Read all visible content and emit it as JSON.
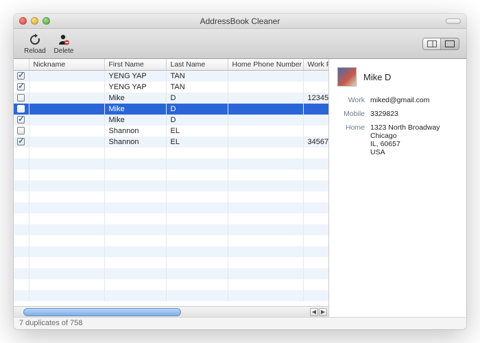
{
  "window": {
    "title": "AddressBook Cleaner"
  },
  "toolbar": {
    "reload_label": "Reload",
    "delete_label": "Delete"
  },
  "columns": {
    "check": "",
    "nickname": "Nickname",
    "first": "First Name",
    "last": "Last Name",
    "homephone": "Home Phone Number",
    "workphone": "Work Ph"
  },
  "rows": [
    {
      "checked": true,
      "nickname": "",
      "first": "YENG YAP",
      "last": "TAN",
      "homephone": "",
      "workphone": ""
    },
    {
      "checked": true,
      "nickname": "",
      "first": "YENG YAP",
      "last": "TAN",
      "homephone": "",
      "workphone": ""
    },
    {
      "checked": false,
      "nickname": "",
      "first": "Mike",
      "last": "D",
      "homephone": "",
      "workphone": "12345"
    },
    {
      "checked": true,
      "nickname": "",
      "first": "Mike",
      "last": "D",
      "homephone": "",
      "workphone": "",
      "selected": true
    },
    {
      "checked": true,
      "nickname": "",
      "first": "Mike",
      "last": "D",
      "homephone": "",
      "workphone": ""
    },
    {
      "checked": false,
      "nickname": "",
      "first": "Shannon",
      "last": "EL",
      "homephone": "",
      "workphone": ""
    },
    {
      "checked": true,
      "nickname": "",
      "first": "Shannon",
      "last": "EL",
      "homephone": "",
      "workphone": "34567"
    }
  ],
  "empty_row_count": 14,
  "status": "7 duplicates of 758",
  "detail": {
    "name": "Mike D",
    "fields": [
      {
        "label": "Work",
        "value": "miked@gmail.com"
      },
      {
        "label": "Mobile",
        "value": "3329823"
      },
      {
        "label": "Home",
        "value": "1323 North Broadway\nChicago\nIL, 60657\nUSA"
      }
    ]
  }
}
